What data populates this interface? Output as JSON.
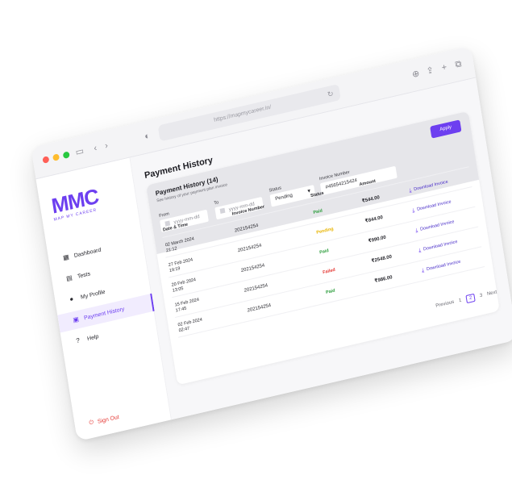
{
  "browser": {
    "url": "https://mapmycareer.in/",
    "window_controls": [
      "close",
      "minimize",
      "maximize"
    ]
  },
  "brand": {
    "logo_text": "MMC",
    "logo_subtitle": "MAP MY CAREER",
    "accent_color": "#6d3ff0"
  },
  "sidebar": {
    "items": [
      {
        "label": "Dashboard",
        "icon": "grid-icon",
        "active": false
      },
      {
        "label": "Tests",
        "icon": "clipboard-icon",
        "active": false
      },
      {
        "label": "My Profile",
        "icon": "user-icon",
        "active": false
      },
      {
        "label": "Payment History",
        "icon": "wallet-icon",
        "active": true
      },
      {
        "label": "Help",
        "icon": "help-icon",
        "active": false
      }
    ],
    "signout_label": "Sign Out"
  },
  "page": {
    "title": "Payment  History"
  },
  "card": {
    "title": "Payment  History (14)",
    "subtitle": "See history of your payment plan invoice",
    "filters": {
      "from_label": "From",
      "from_placeholder": "yyyy-mm-dd",
      "to_label": "To",
      "to_placeholder": "yyyy-mm-dd",
      "status_label": "Status",
      "status_value": "Pending",
      "invoice_label": "Invoice Number",
      "invoice_value": "#45654215424",
      "apply_label": "Apply"
    },
    "table": {
      "columns": [
        "Date & Time",
        "Invoice Number",
        "Status",
        "Amount",
        ""
      ],
      "rows": [
        {
          "date": "02 March 2024",
          "time": "21:12",
          "invoice": "202154254",
          "status": "Paid",
          "status_color": "#2e9e3e",
          "amount": "₹544.00",
          "action": "Download Invoice"
        },
        {
          "date": "27 Feb 2024",
          "time": "19:19",
          "invoice": "202154254",
          "status": "Pending",
          "status_color": "#e8b400",
          "amount": "₹844.00",
          "action": "Download Invoice"
        },
        {
          "date": "20 Feb 2024",
          "time": "13:05",
          "invoice": "202154254",
          "status": "Paid",
          "status_color": "#2e9e3e",
          "amount": "₹990.00",
          "action": "Download Invoice"
        },
        {
          "date": "15 Feb 2024",
          "time": "17:45",
          "invoice": "202154254",
          "status": "Failed",
          "status_color": "#e53935",
          "amount": "₹2548.00",
          "action": "Download Invoice"
        },
        {
          "date": "02 Feb 2024",
          "time": "02:47",
          "invoice": "202154254",
          "status": "Paid",
          "status_color": "#2e9e3e",
          "amount": "₹986.00",
          "action": "Download Invoice"
        }
      ]
    },
    "pagination": {
      "previous_label": "Previous",
      "pages": [
        "1",
        "2",
        "3"
      ],
      "current_page": "2",
      "next_label": "Next"
    }
  }
}
